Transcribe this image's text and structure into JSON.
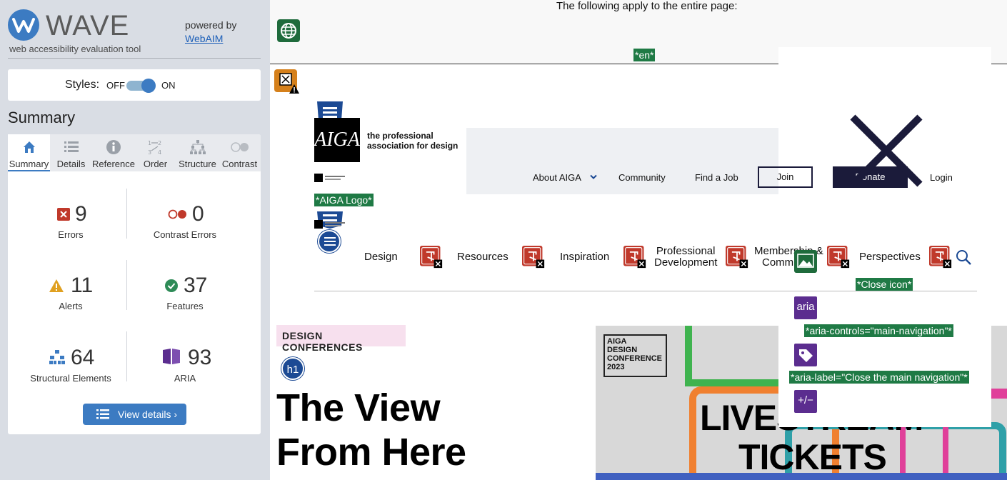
{
  "wave": {
    "title": "WAVE",
    "subtitle": "web accessibility evaluation tool",
    "powered_by": "powered by",
    "webaim_link": "WebAIM",
    "styles_label": "Styles:",
    "off_label": "OFF",
    "on_label": "ON",
    "styles_on": true,
    "summary_title": "Summary",
    "tabs": [
      {
        "label": "Summary",
        "icon": "home-icon",
        "active": true
      },
      {
        "label": "Details",
        "icon": "list-icon",
        "active": false
      },
      {
        "label": "Reference",
        "icon": "info-icon",
        "active": false
      },
      {
        "label": "Order",
        "icon": "order-icon",
        "active": false
      },
      {
        "label": "Structure",
        "icon": "structure-icon",
        "active": false
      },
      {
        "label": "Contrast",
        "icon": "contrast-icon",
        "active": false
      }
    ],
    "stats": {
      "errors": {
        "count": "9",
        "label": "Errors",
        "color": "#c0392b"
      },
      "contrast_errors": {
        "count": "0",
        "label": "Contrast Errors",
        "color": "#c0392b"
      },
      "alerts": {
        "count": "11",
        "label": "Alerts",
        "color": "#e0a020"
      },
      "features": {
        "count": "37",
        "label": "Features",
        "color": "#2e8b57"
      },
      "structural": {
        "count": "64",
        "label": "Structural Elements",
        "color": "#3c7bc2"
      },
      "aria": {
        "count": "93",
        "label": "ARIA",
        "color": "#5b2d8f"
      }
    },
    "view_details": "View details ›"
  },
  "page": {
    "apply_text": "The following apply to the entire page:",
    "lang_tag": "*en*",
    "logo_alt_tag": "*AIGA Logo*",
    "aiga_mark": "AIGA",
    "aiga_tagline_1": "the professional",
    "aiga_tagline_2": "association for design",
    "utility_nav": [
      "About AIGA",
      "Community",
      "Find a Job"
    ],
    "join": "Join",
    "donate": "Donate",
    "login": "Login",
    "main_nav": [
      "Design",
      "Resources",
      "Inspiration",
      "Professional",
      "Development",
      "Membership &",
      "Comm",
      "Perspectives"
    ],
    "close_icon_tag": "*Close icon*",
    "aria_badge": "aria",
    "aria_controls_tag": "*aria-controls=\"main-navigation\"*",
    "aria_label_tag": "*aria-label=\"Close the main navigation\"*",
    "expand_badge": "+/−",
    "design_conf_badge": "DESIGN CONFERENCES",
    "h1_badge": "h1",
    "hero_line_1": "The View",
    "hero_line_2": "From Here",
    "conf_logo": [
      "AIGA",
      "DESIGN",
      "CONFERENCE",
      "2023"
    ],
    "hero_livestream": "LIVESTREAM",
    "hero_tickets": "TICKETS"
  },
  "colors": {
    "wave_blue": "#3c7bc2",
    "wave_sidebar_bg": "#d9dde4",
    "green_tag": "#1f7a45",
    "aiga_navy": "#1b1b3a",
    "purple_aria": "#5b2d8f",
    "error_red": "#c0392b"
  }
}
